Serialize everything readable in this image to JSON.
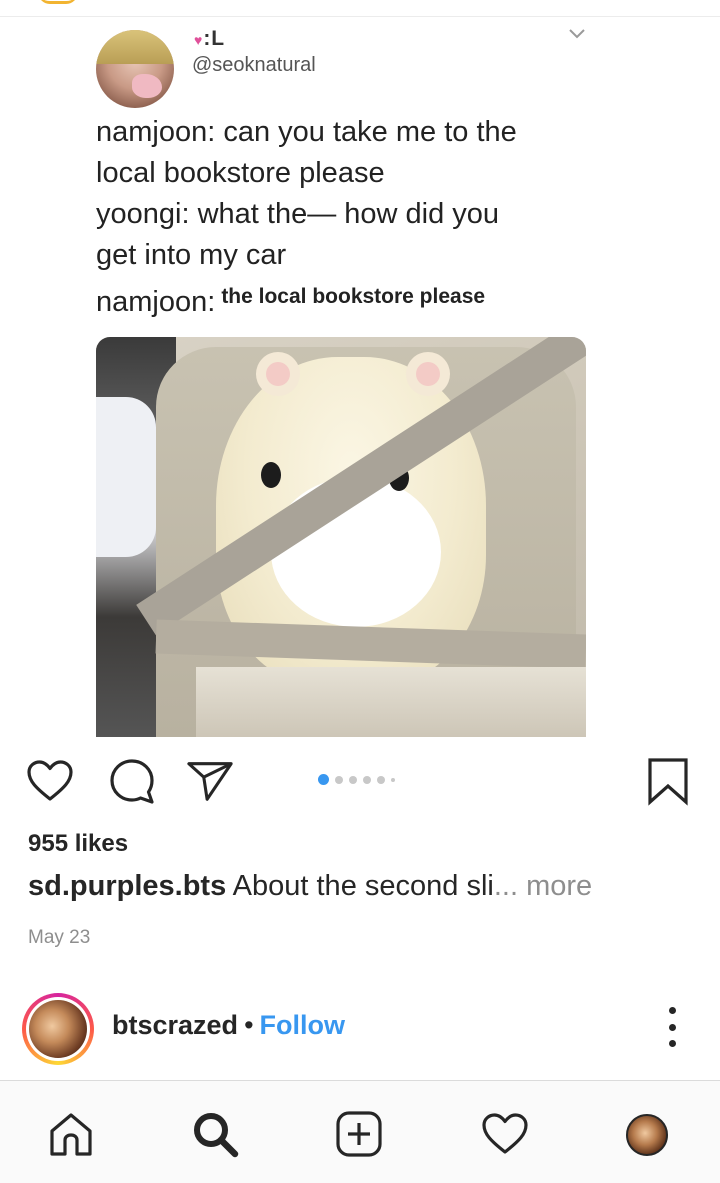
{
  "post": {
    "tweet": {
      "display_name": ":L",
      "handle": "@seoknatural",
      "lines": [
        "namjoon: can you take me to the",
        "local bookstore please",
        "yoongi: what the— how did you",
        "get into my car"
      ],
      "last_line_prefix": "namjoon:",
      "last_line_small": "the local bookstore please"
    },
    "carousel": {
      "count": 6,
      "active_index": 0
    },
    "likes": "955 likes",
    "caption_user": "sd.purples.bts",
    "caption_text": " About the second sli",
    "caption_more": "... more",
    "date": "May 23"
  },
  "next_post": {
    "username": "btscrazed",
    "separator": "•",
    "follow_label": "Follow"
  },
  "colors": {
    "accent_blue": "#3897f0",
    "text": "#262626",
    "muted": "#8e8e8e"
  },
  "icons": {
    "like": "heart-icon",
    "comment": "comment-icon",
    "share": "paper-plane-icon",
    "save": "bookmark-icon",
    "home": "home-icon",
    "search": "search-icon",
    "new_post": "plus-square-icon",
    "activity": "heart-icon",
    "more": "more-vertical-icon"
  }
}
